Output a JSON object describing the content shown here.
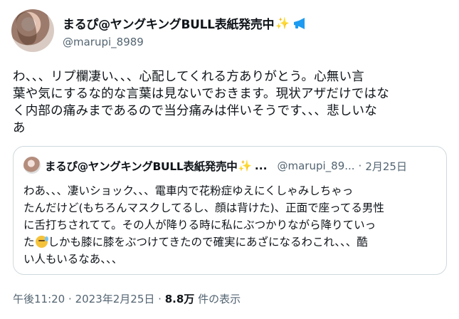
{
  "author": {
    "display_name": "まるぴ@ヤングキングBULL表紙発売中",
    "sparkle": "✨",
    "handle": "@marupi_8989"
  },
  "tweet": {
    "lines": [
      "わ、、、リプ欄凄い、、、心配してくれる方ありがとう。心無い言",
      "葉や気にするな的な言葉は見ないでおきます。現状アザだけではな",
      "く内部の痛みまであるので当分痛みは伴いそうです、、、悲しいな",
      "あ"
    ]
  },
  "quote": {
    "display_name": "まるぴ@ヤングキングBULL表紙発売中",
    "sparkle": "✨",
    "ellipsis": "...",
    "handle": "@marupi_89...",
    "dot": "·",
    "date": "2月25日",
    "lines": [
      "わあ、、、凄いショック、、、電車内で花粉症ゆえにくしゃみしちゃっ",
      "たんだけど(もちろんマスクしてるし、顔は背けた)、正面で座ってる男性",
      "に舌打ちされてて。その人が降りる時に私にぶつかりながら降りていっ",
      "た",
      "しかも膝に膝をぶつけてきたので確実にあざになるわこれ、、、酷",
      "い人もいるなあ、、、"
    ]
  },
  "meta": {
    "time": "午後11:20",
    "dot": "·",
    "date": "2023年2月25日",
    "views_count": "8.8万",
    "views_label": "件の表示"
  },
  "colors": {
    "text": "#0f1419",
    "secondary": "#536471",
    "border": "#cfd9de",
    "megaphone": "#1d9bf0"
  },
  "icons": [
    "sparkles-icon",
    "megaphone-icon",
    "sweat-smile-emoji-icon"
  ]
}
